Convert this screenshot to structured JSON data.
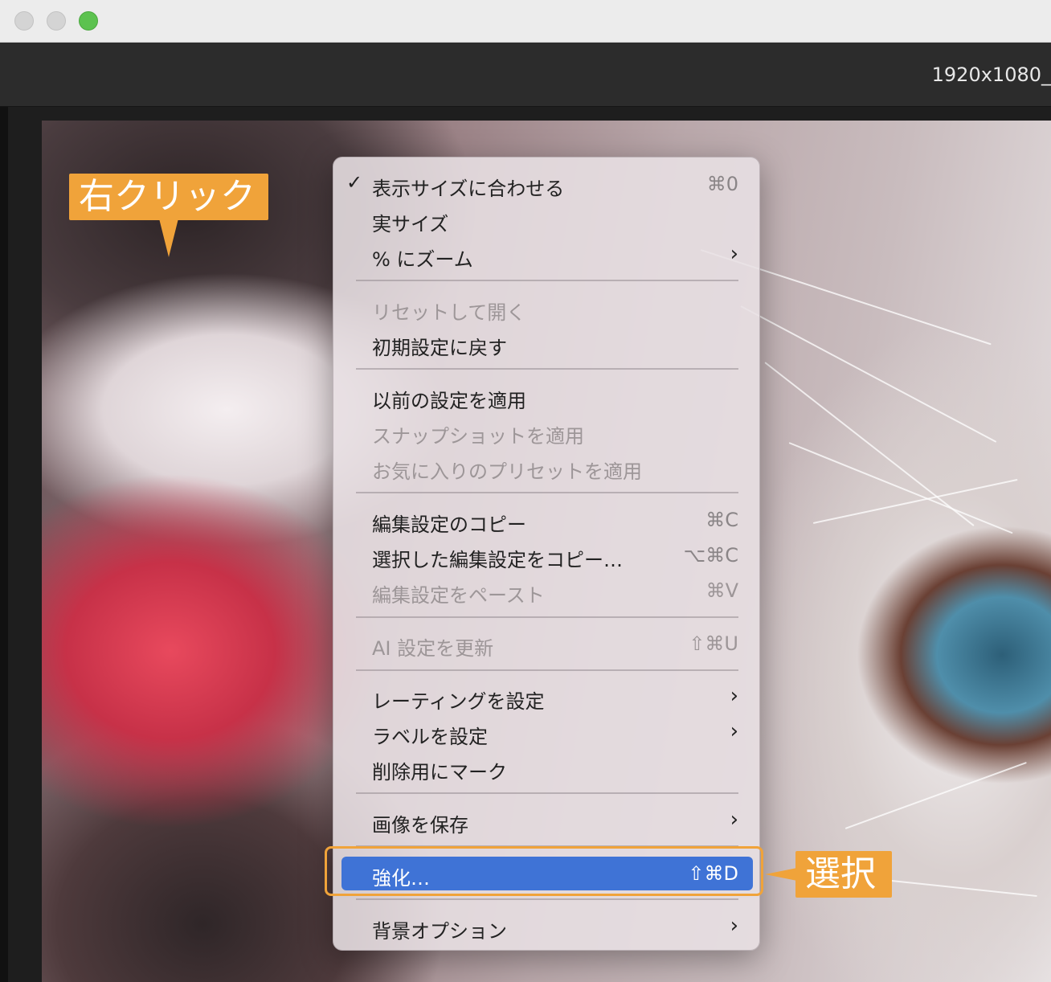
{
  "window": {
    "filename": "1920x1080_"
  },
  "callouts": {
    "right_click": "右クリック",
    "select": "選択"
  },
  "menu": {
    "items": [
      {
        "label": "表示サイズに合わせる",
        "shortcut": "⌘0",
        "checked": true
      },
      {
        "label": "実サイズ"
      },
      {
        "label": "% にズーム",
        "submenu": true
      },
      {
        "label": "リセットして開く",
        "disabled": true
      },
      {
        "label": "初期設定に戻す"
      },
      {
        "label": "以前の設定を適用"
      },
      {
        "label": "スナップショットを適用",
        "disabled": true
      },
      {
        "label": "お気に入りのプリセットを適用",
        "disabled": true
      },
      {
        "label": "編集設定のコピー",
        "shortcut": "⌘C"
      },
      {
        "label": "選択した編集設定をコピー…",
        "shortcut": "⌥⌘C"
      },
      {
        "label": "編集設定をペースト",
        "shortcut": "⌘V",
        "disabled": true
      },
      {
        "label": "AI 設定を更新",
        "shortcut": "⇧⌘U",
        "disabled": true
      },
      {
        "label": "レーティングを設定",
        "submenu": true
      },
      {
        "label": "ラベルを設定",
        "submenu": true
      },
      {
        "label": "削除用にマーク"
      },
      {
        "label": "画像を保存",
        "submenu": true
      },
      {
        "label": "強化…",
        "shortcut": "⇧⌘D",
        "active": true
      },
      {
        "label": "背景オプション",
        "submenu": true
      }
    ],
    "check_glyph": "✓",
    "chevron_glyph": "›"
  },
  "icons": {
    "check": "checkmark-icon",
    "submenu": "chevron-right-icon"
  },
  "colors": {
    "accent": "#3f73d6",
    "callout": "#f0a33a",
    "traffic_green": "#5cc24f"
  }
}
